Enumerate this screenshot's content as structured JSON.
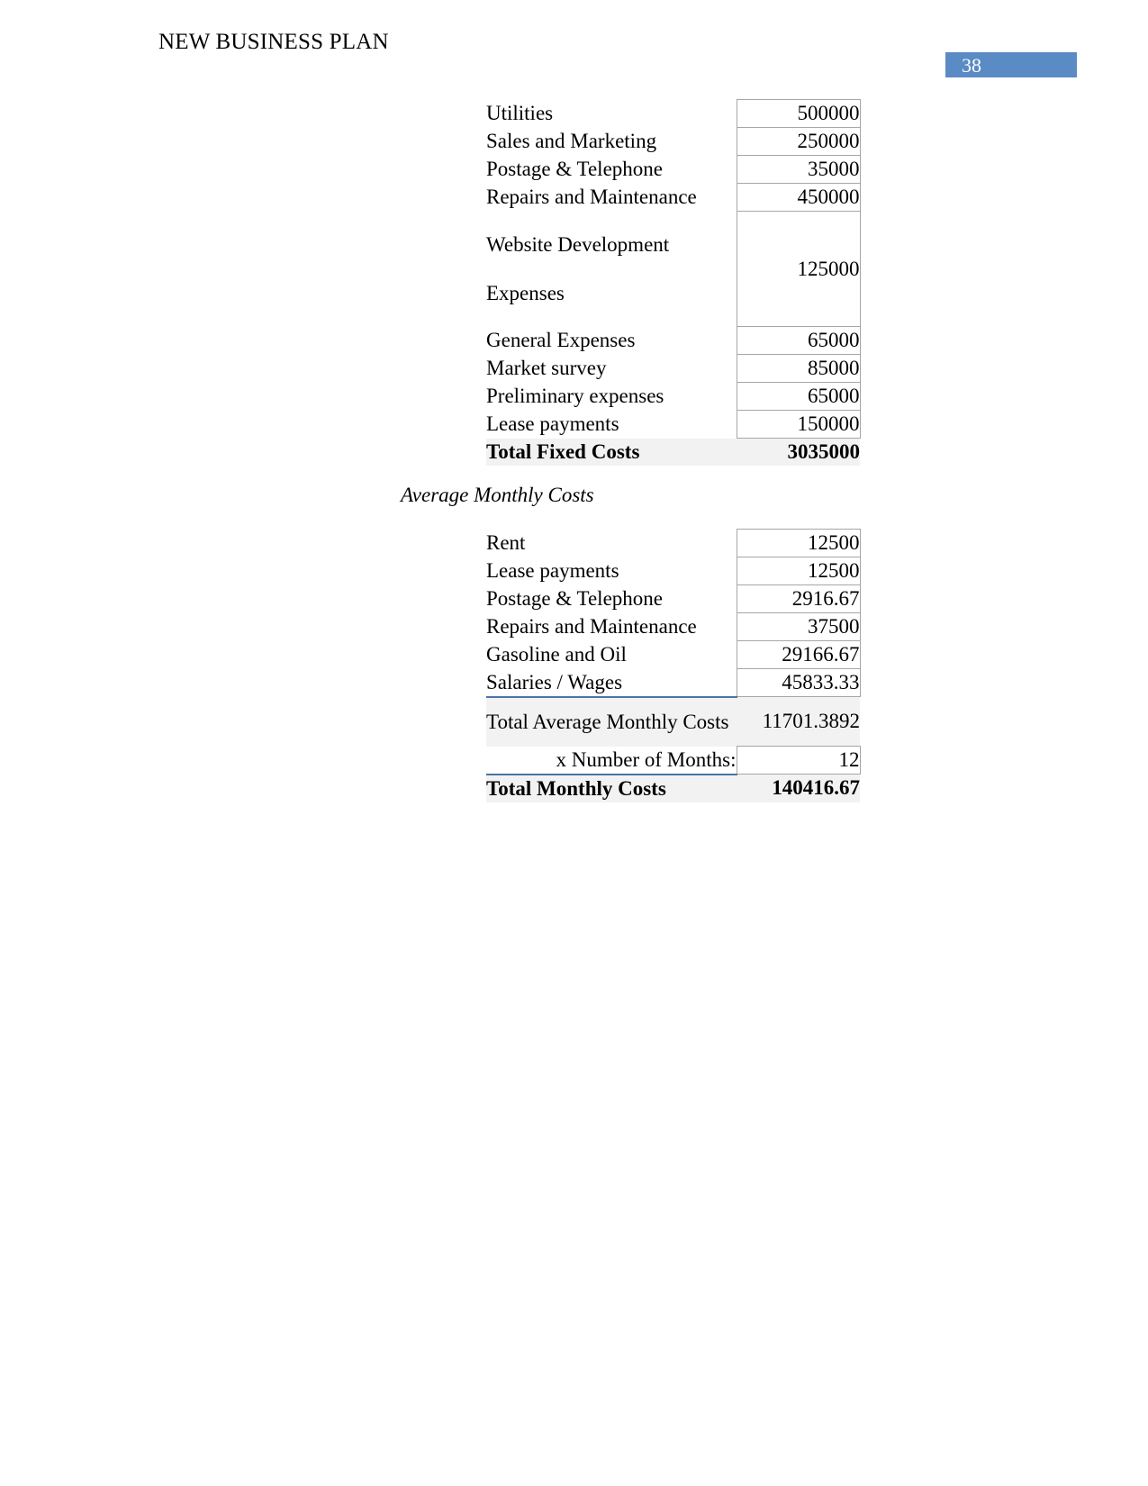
{
  "header": {
    "title": "NEW BUSINESS PLAN",
    "page_number": "38",
    "badge_color": "#5B8BC4"
  },
  "fixed_costs_table": {
    "rows": [
      {
        "label": "Utilities",
        "value": "500000"
      },
      {
        "label": "Sales and Marketing",
        "value": "250000"
      },
      {
        "label": "Postage & Telephone",
        "value": "35000"
      },
      {
        "label": "Repairs and Maintenance",
        "value": "450000"
      },
      {
        "label": "Website Development Expenses",
        "value": "125000"
      },
      {
        "label": "General Expenses",
        "value": "65000"
      },
      {
        "label": "Market survey",
        "value": "85000"
      },
      {
        "label": "Preliminary  expenses",
        "value": "65000"
      },
      {
        "label": "Lease payments",
        "value": "150000"
      }
    ],
    "total": {
      "label": "Total Fixed Costs",
      "value": "3035000"
    }
  },
  "section_heading": "Average Monthly Costs",
  "monthly_costs_table": {
    "rows": [
      {
        "label": "Rent",
        "value": "12500"
      },
      {
        "label": "Lease payments",
        "value": "12500"
      },
      {
        "label": "Postage & Telephone",
        "value": "2916.67"
      },
      {
        "label": "Repairs and Maintenance",
        "value": "37500"
      },
      {
        "label": "Gasoline and Oil",
        "value": "29166.67"
      },
      {
        "label": "Salaries / Wages",
        "value": "45833.33"
      }
    ],
    "total_average": {
      "label": "Total Average Monthly Costs",
      "value": "11701.3892"
    },
    "months": {
      "label": "x Number of Months:",
      "value": "12"
    },
    "grand_total": {
      "label": "Total Monthly Costs",
      "value": "140416.67"
    }
  }
}
